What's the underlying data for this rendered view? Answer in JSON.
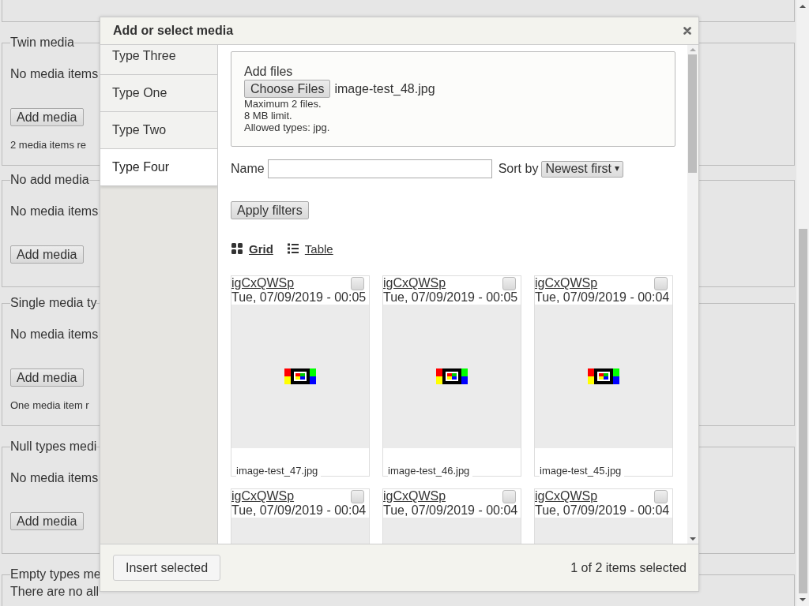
{
  "page": {
    "fieldsets": [
      {
        "legend": "Twin media",
        "message": "No media items",
        "button": "Add media",
        "help": "2 media items re"
      },
      {
        "legend": "No add media",
        "message": "No media items",
        "button": "Add media"
      },
      {
        "legend": "Single media ty",
        "message": "No media items",
        "button": "Add media",
        "help": "One media item r"
      },
      {
        "legend": "Null types medi",
        "message": "No media items",
        "button": "Add media"
      },
      {
        "legend": "Empty types me",
        "message": "There are no all"
      }
    ]
  },
  "dialog": {
    "title": "Add or select media",
    "tabs": [
      {
        "label": "Type Three",
        "selected": false
      },
      {
        "label": "Type One",
        "selected": false
      },
      {
        "label": "Type Two",
        "selected": false
      },
      {
        "label": "Type Four",
        "selected": true
      }
    ],
    "upload": {
      "label": "Add files",
      "button": "Choose Files",
      "file": "image-test_48.jpg",
      "help": [
        "Maximum 2 files.",
        "8 MB limit.",
        "Allowed types: jpg."
      ]
    },
    "filters": {
      "name_label": "Name",
      "sort_label": "Sort by",
      "sort_value": "Newest first",
      "apply": "Apply filters"
    },
    "views": [
      {
        "label": "Grid",
        "kind": "grid",
        "selected": true
      },
      {
        "label": "Table",
        "kind": "table",
        "selected": false
      }
    ],
    "items": [
      {
        "title": "igCxQWSp",
        "date": "Tue, 07/09/2019 - 00:05",
        "checked": false,
        "kind": "picture",
        "filename": "image-test_47.jpg"
      },
      {
        "title": "igCxQWSp",
        "date": "Tue, 07/09/2019 - 00:05",
        "checked": false,
        "kind": "picture",
        "filename": "image-test_46.jpg"
      },
      {
        "title": "igCxQWSp",
        "date": "Tue, 07/09/2019 - 00:04",
        "checked": false,
        "kind": "picture",
        "filename": "image-test_45.jpg"
      },
      {
        "title": "igCxQWSp",
        "date": "Tue, 07/09/2019 - 00:04",
        "checked": false
      },
      {
        "title": "igCxQWSp",
        "date": "Tue, 07/09/2019 - 00:04",
        "checked": false
      },
      {
        "title": "igCxQWSp",
        "date": "Tue, 07/09/2019 - 00:04",
        "checked": false
      }
    ],
    "footer": {
      "button": "Insert selected",
      "status": "1 of 2 items selected"
    }
  }
}
